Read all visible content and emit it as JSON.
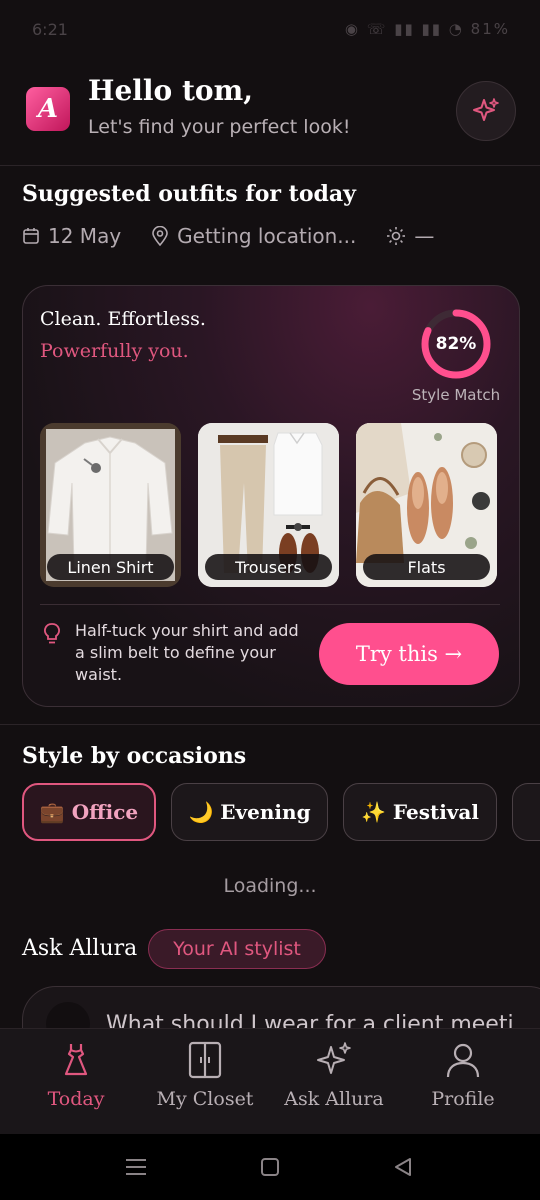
{
  "status_bar": {
    "time": "6:21",
    "icons": "◉ ☏ ▮▮ ▮▮ ◔ 81%"
  },
  "header": {
    "logo_letter": "A",
    "greeting": "Hello tom,",
    "subtitle": "Let's find your perfect look!",
    "sparkle_icon": "sparkle-icon"
  },
  "suggested": {
    "title": "Suggested outfits for today",
    "date": "12 May",
    "location": "Getting location...",
    "weather": "—"
  },
  "outfit_card": {
    "headline": "Clean. Effortless.",
    "tagline": "Powerfully you.",
    "match_percent_label": "82%",
    "match_fraction": 0.82,
    "match_label": "Style Match",
    "items": [
      {
        "label": "Linen Shirt"
      },
      {
        "label": "Trousers"
      },
      {
        "label": "Flats"
      }
    ],
    "tip": "Half-tuck your shirt and add a slim belt to define your waist.",
    "cta": "Try this →"
  },
  "occasions": {
    "title": "Style by occasions",
    "chips": [
      {
        "label": "💼 Office",
        "active": true
      },
      {
        "label": "🌙 Evening",
        "active": false
      },
      {
        "label": "✨ Festival",
        "active": false
      }
    ],
    "loading": "Loading..."
  },
  "ask": {
    "title": "Ask Allura",
    "badge": "Your AI stylist",
    "prompt": "What should I wear for a client meeti"
  },
  "nav": {
    "items": [
      {
        "label": "Today",
        "icon": "dress-icon",
        "active": true
      },
      {
        "label": "My Closet",
        "icon": "wardrobe-icon",
        "active": false
      },
      {
        "label": "Ask Allura",
        "icon": "sparkles-icon",
        "active": false
      },
      {
        "label": "Profile",
        "icon": "person-icon",
        "active": false
      }
    ]
  },
  "colors": {
    "accent": "#e0577f",
    "cta": "#ff4f8e",
    "background": "#130f11"
  }
}
